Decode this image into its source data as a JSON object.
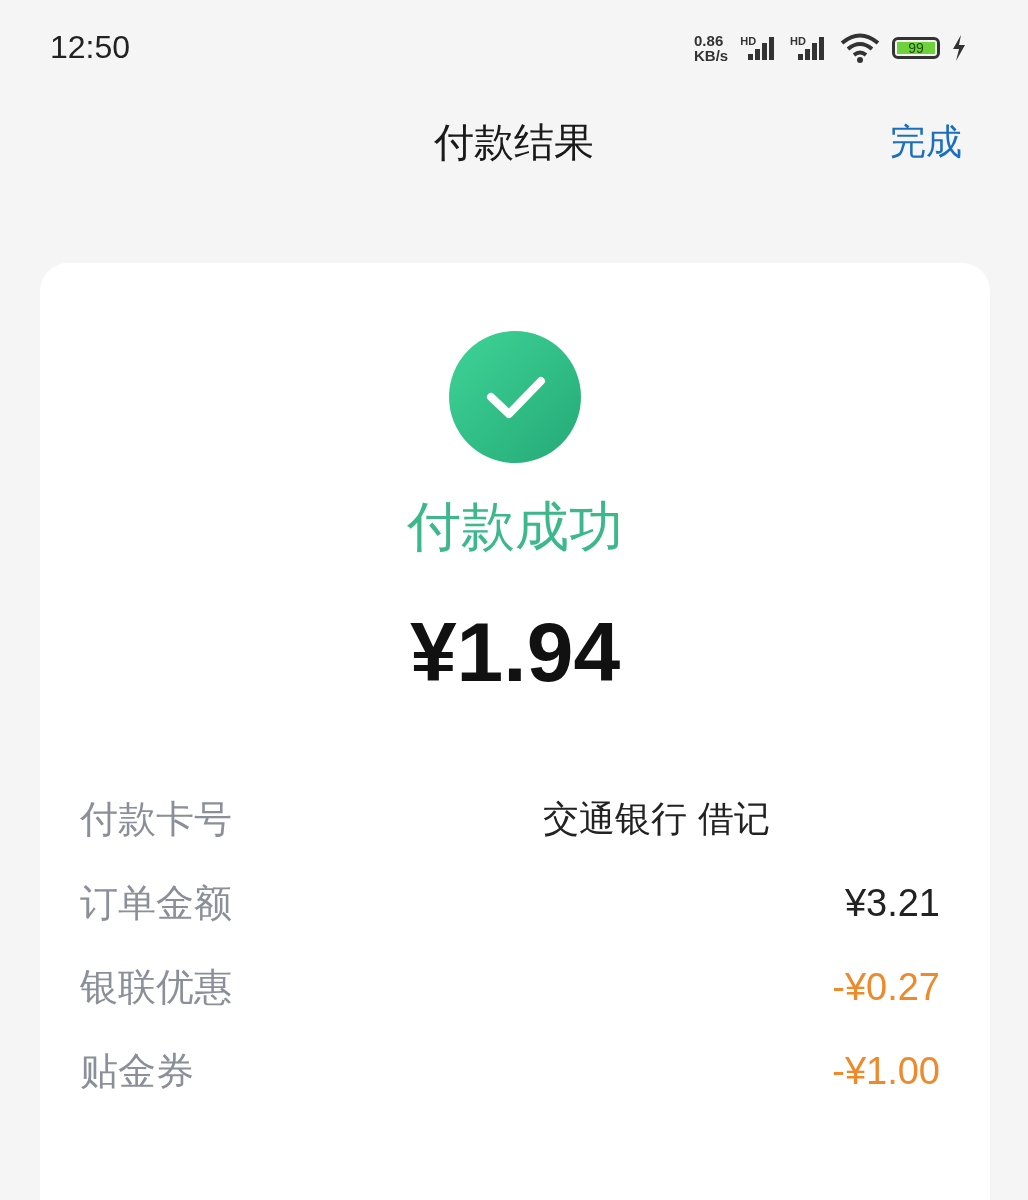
{
  "status_bar": {
    "time": "12:50",
    "speed": [
      "0.86",
      "KB/s"
    ],
    "signal_labels": [
      "HD",
      "HD"
    ],
    "battery": "99"
  },
  "header": {
    "title": "付款结果",
    "done": "完成"
  },
  "result": {
    "status": "付款成功",
    "amount": "¥1.94"
  },
  "details": [
    {
      "label": "付款卡号",
      "value": "交通银行 借记",
      "kind": "card",
      "color": "#222222"
    },
    {
      "label": "订单金额",
      "value": "¥3.21",
      "kind": "amount",
      "color": "#222222"
    },
    {
      "label": "银联优惠",
      "value": "-¥0.27",
      "kind": "amount",
      "color": "#ee8a2c"
    },
    {
      "label": "贴金券",
      "value": "-¥1.00",
      "kind": "amount",
      "color": "#ee8a2c"
    }
  ]
}
